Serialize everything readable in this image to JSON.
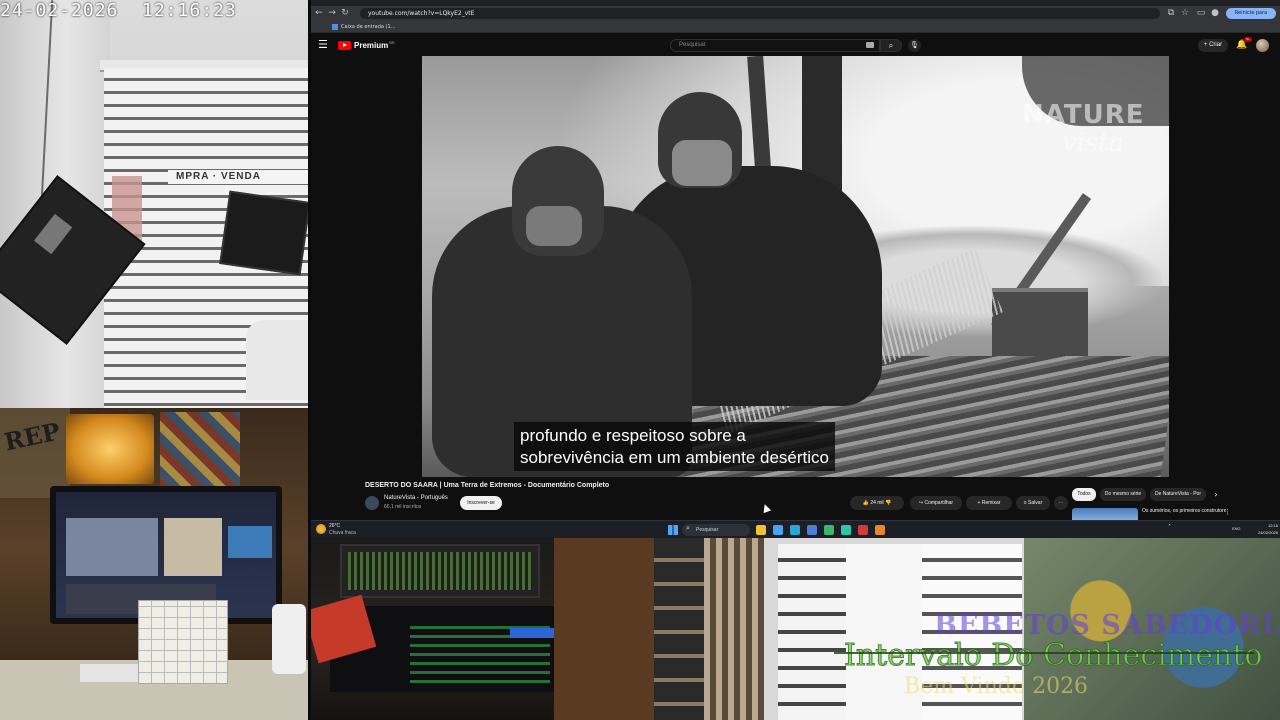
{
  "camera": {
    "timestamp": "24-02-2026  12:16:23",
    "sign_text": "MPRA · VENDA",
    "desk_graffiti": "REP"
  },
  "browser": {
    "url": "youtube.com/watch?v=LQkyE2_vtE",
    "update_button": "Reinicie para atualizar",
    "bookmark": "Caixa de entrada (1...",
    "icons": [
      "back-icon",
      "forward-icon",
      "reload-icon",
      "extensions-icon",
      "star-icon",
      "profile-icon"
    ]
  },
  "youtube": {
    "logo_text": "Premium",
    "logo_sup": "BR",
    "search_placeholder": "Pesquisar",
    "create_label": "+ Criar",
    "notifications_badge": "9+",
    "video": {
      "watermark_line1": "NATURE",
      "watermark_line2": "vista",
      "subtitle_line1": "profundo e respeitoso sobre a",
      "subtitle_line2": "sobrevivência em um ambiente desértico"
    },
    "title": "DESERTO DO SAARA | Uma Terra de Extremos - Documentário Completo",
    "channel": {
      "name": "NatureVista - Português",
      "subscribers": "66,1 mil inscritos",
      "subscribe_label": "Inscrever-se"
    },
    "actions": {
      "likes": "👍 24 mil",
      "dislike": "👎",
      "share": "↪ Compartilhar",
      "download": "+ Remixar",
      "save": "≡ Salvar",
      "more": "⋯"
    },
    "chips": [
      "Todos",
      "Do mesmo série",
      "De NatureVista - Por"
    ],
    "recommendation_title": "Os sumérios, os primeiros construtores da história"
  },
  "taskbar": {
    "weather_temp": "26°C",
    "weather_desc": "Chuva fraca",
    "search_label": "Pesquisar",
    "apps": [
      {
        "name": "file-explorer",
        "color": "#f2c230"
      },
      {
        "name": "chrome",
        "color": "#4aa3f0"
      },
      {
        "name": "edge",
        "color": "#25a8d8"
      },
      {
        "name": "store",
        "color": "#4f7ed8"
      },
      {
        "name": "app-green",
        "color": "#3ab86a"
      },
      {
        "name": "app-teal",
        "color": "#2ac8a8"
      },
      {
        "name": "app-red",
        "color": "#d43a3a"
      },
      {
        "name": "app-orange",
        "color": "#e8862a"
      }
    ],
    "language": "ENG",
    "time": "12:16",
    "date": "24/02/2026"
  },
  "overlay": {
    "line1": "BEBETOS SABEDORIA",
    "line2": "Intervalo Do Conhecimento",
    "line3": "Bem Vindo 2026"
  },
  "colors": {
    "youtube_red": "#ff0000",
    "overlay_green": "#7ed957",
    "overlay_purple": "#6040d8",
    "overlay_yellow": "#e6e16a"
  }
}
